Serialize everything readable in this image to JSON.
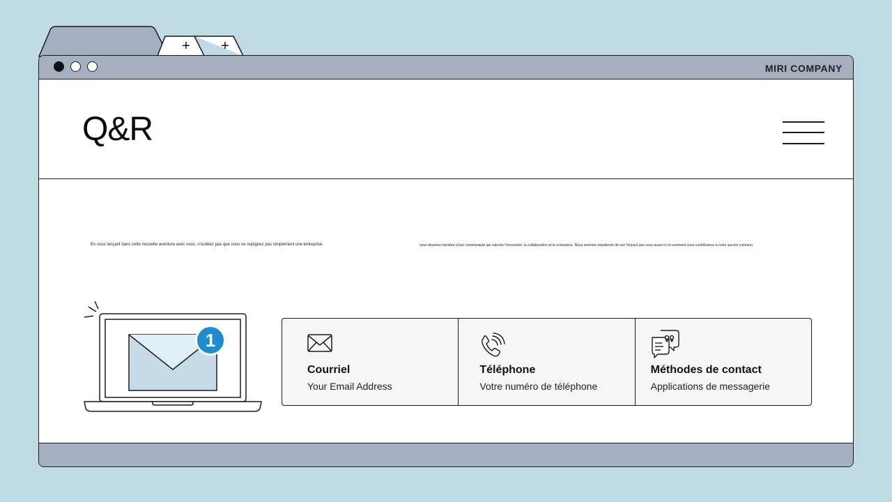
{
  "browser": {
    "new_tab_symbol": "+",
    "company": "MIRI COMPANY"
  },
  "header": {
    "logo": "Q&R"
  },
  "intro": {
    "left_text": "En vous lançant dans cette nouvelle aventure avec nous, n'oubliez pas que vous ne rejoignez pas simplement une entreprise.",
    "right_text": "vous devenez membre d'une communauté qui valorise l'innovation, la collaboration et la croissance. Nous sommes impatients de voir l'impact que vous aurez ici et comment vous contribuerez à notre succès commun."
  },
  "illustration": {
    "notification_count": "1",
    "badge_color": "#1e8bd3"
  },
  "contacts": [
    {
      "icon": "envelope-icon",
      "title": "Courriel",
      "subtitle": "Your Email Address"
    },
    {
      "icon": "phone-icon",
      "title": "Téléphone",
      "subtitle": "Votre numéro de téléphone"
    },
    {
      "icon": "chat-bubbles-icon",
      "title": "Méthodes de contact",
      "subtitle": "Applications de messagerie"
    }
  ],
  "colors": {
    "page_bg": "#c0dbe3",
    "chrome": "#a4afbf",
    "card_bg": "#f6f6f7"
  }
}
